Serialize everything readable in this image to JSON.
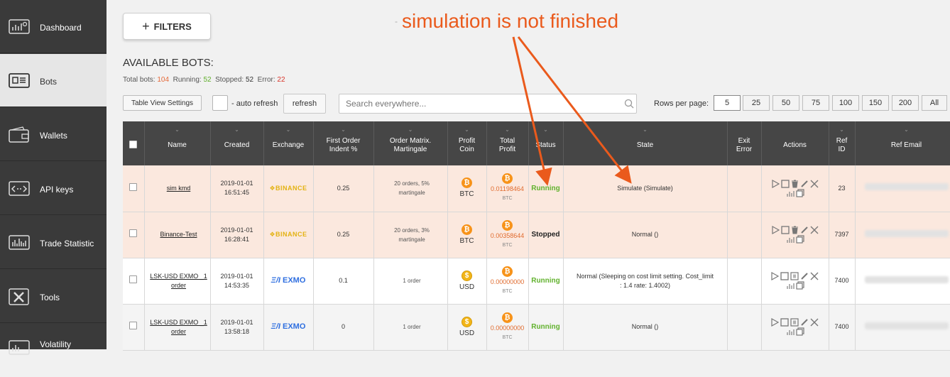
{
  "sidebar": {
    "items": [
      {
        "label": "Dashboard",
        "icon": "dashboard-icon"
      },
      {
        "label": "Bots",
        "icon": "bots-icon",
        "active": true
      },
      {
        "label": "Wallets",
        "icon": "wallet-icon"
      },
      {
        "label": "API keys",
        "icon": "api-icon"
      },
      {
        "label": "Trade Statistic",
        "icon": "chart-icon"
      },
      {
        "label": "Tools",
        "icon": "tools-icon"
      },
      {
        "label": "Volatility",
        "icon": "volatility-icon"
      }
    ]
  },
  "toolbar": {
    "filters_label": "FILTERS",
    "filters_icon": "+",
    "table_view_settings_label": "Table View Settings",
    "auto_refresh_label": "- auto refresh",
    "refresh_label": "refresh",
    "search_placeholder": "Search everywhere...",
    "rows_per_page_label": "Rows per page:",
    "rows_per_page_current": "5",
    "rows_per_page_options": [
      "5",
      "25",
      "50",
      "75",
      "100",
      "150",
      "200",
      "All"
    ]
  },
  "annotation": {
    "text": "simulation is not finished",
    "dot": "-",
    "color": "#ea5a1c"
  },
  "page": {
    "title": "AVAILABLE BOTS:",
    "counts": {
      "total_label": "Total bots:",
      "total": "104",
      "running_label": "Running:",
      "running": "52",
      "stopped_label": "Stopped:",
      "stopped": "52",
      "error_label": "Error:",
      "error": "22"
    }
  },
  "table": {
    "caret": "⌄",
    "headers": {
      "name": "Name",
      "created": "Created",
      "exchange": "Exchange",
      "first_order_1": "First Order",
      "first_order_2": "Indent %",
      "matrix_1": "Order Matrix.",
      "matrix_2": "Martingale",
      "profit_coin_1": "Profit",
      "profit_coin_2": "Coin",
      "total_profit_1": "Total",
      "total_profit_2": "Profit",
      "status": "Status",
      "state": "State",
      "exit_error_1": "Exit",
      "exit_error_2": "Error",
      "actions": "Actions",
      "ref_id_1": "Ref",
      "ref_id_2": "ID",
      "ref_email": "Ref Email"
    },
    "rows": [
      {
        "name": "sim kmd",
        "created_date": "2019-01-01",
        "created_time": "16:51:45",
        "exchange": "BINANCE",
        "indent": "0.25",
        "matrix_1": "20 orders, 5%",
        "matrix_2": "martingale",
        "coin_symbol": "₿",
        "coin": "BTC",
        "profit_symbol": "₿",
        "profit": "0.01198464",
        "profit_cur": "BTC",
        "status": "Running",
        "state": "Simulate (Simulate)",
        "state_2": "",
        "exit_error": "",
        "ref_id": "23"
      },
      {
        "name": "Binance-Test",
        "created_date": "2019-01-01",
        "created_time": "16:28:41",
        "exchange": "BINANCE",
        "indent": "0.25",
        "matrix_1": "20 orders, 3%",
        "matrix_2": "martingale",
        "coin_symbol": "₿",
        "coin": "BTC",
        "profit_symbol": "₿",
        "profit": "0.00358644",
        "profit_cur": "BTC",
        "status": "Stopped",
        "state": "Normal ()",
        "state_2": "",
        "exit_error": "",
        "ref_id": "7397"
      },
      {
        "name": "LSK-USD EXMO _1",
        "name_2": "order",
        "created_date": "2019-01-01",
        "created_time": "14:53:35",
        "exchange": "EXMO",
        "indent": "0.1",
        "matrix_1": "1 order",
        "matrix_2": "",
        "coin_symbol": "$",
        "coin": "USD",
        "profit_symbol": "₿",
        "profit": "0.00000000",
        "profit_cur": "BTC",
        "status": "Running",
        "state": "Normal (Sleeping on cost limit setting. Cost_limit",
        "state_2": ": 1.4 rate: 1.4002)",
        "exit_error": "",
        "ref_id": "7400"
      },
      {
        "name": "LSK-USD EXMO _1",
        "name_2": "order",
        "created_date": "2019-01-01",
        "created_time": "13:58:18",
        "exchange": "EXMO",
        "indent": "0",
        "matrix_1": "1 order",
        "matrix_2": "",
        "coin_symbol": "$",
        "coin": "USD",
        "profit_symbol": "₿",
        "profit": "0.00000000",
        "profit_cur": "BTC",
        "status": "Running",
        "state": "Normal ()",
        "state_2": "",
        "exit_error": "",
        "ref_id": "7400"
      }
    ]
  }
}
